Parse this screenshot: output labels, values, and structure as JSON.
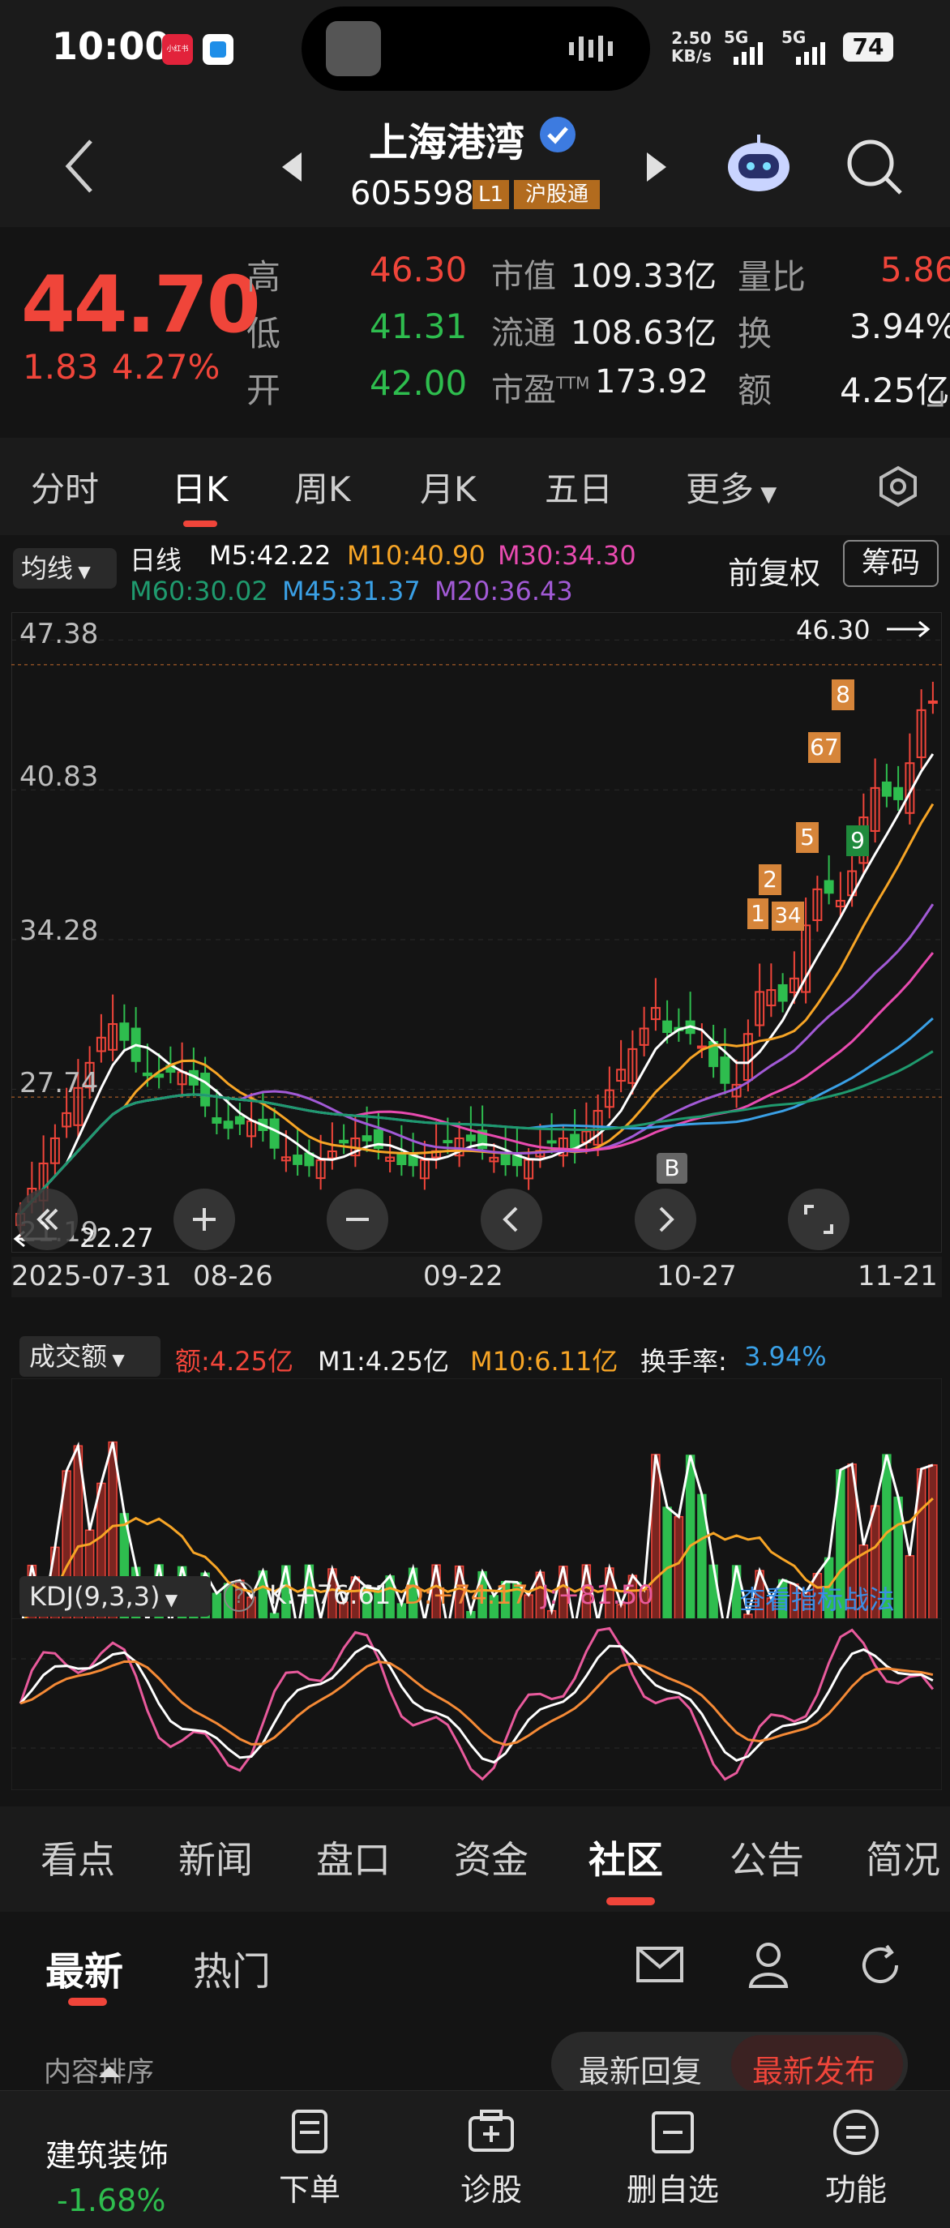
{
  "status_bar": {
    "time": "10:00",
    "app_badge_1": "小红书",
    "net_speed": "2.50",
    "net_unit": "KB/s",
    "sig1": "5G",
    "sig2": "5G",
    "battery": "74"
  },
  "header": {
    "stock_name": "上海港湾",
    "stock_code": "605598",
    "level": "L1",
    "market_tag": "沪股通"
  },
  "quote": {
    "price": "44.70",
    "change": "1.83",
    "change_pct": "4.27%",
    "high_label": "高",
    "high": "46.30",
    "low_label": "低",
    "low": "41.31",
    "open_label": "开",
    "open": "42.00",
    "mcap_label": "市值",
    "mcap": "109.33亿",
    "float_label": "流通",
    "float": "108.63亿",
    "pe_label": "市盈TTM",
    "pe": "173.92",
    "vr_label": "量比",
    "vr": "5.86",
    "turn_label": "换",
    "turn": "3.94%",
    "amt_label": "额",
    "amt": "4.25亿"
  },
  "tabs": [
    "分时",
    "日K",
    "周K",
    "月K",
    "五日",
    "更多"
  ],
  "ma_bar": {
    "selector": "均线",
    "period": "日线",
    "m5": "M5:42.22",
    "m10": "M10:40.90",
    "m30": "M30:34.30",
    "m60": "M60:30.02",
    "m45": "M45:31.37",
    "m20": "M20:36.43",
    "fuquan": "前复权",
    "chouma": "筹码"
  },
  "main_chart": {
    "y_labels": [
      "47.38",
      "40.83",
      "34.28",
      "27.74",
      "21.19"
    ],
    "high_mark": "46.30",
    "low_mark": "22.27",
    "x_labels": [
      "2025-07-31",
      "08-26",
      "09-22",
      "10-27",
      "11-21"
    ],
    "signal_b": "B",
    "markers": [
      "1",
      "2",
      "34",
      "5",
      "67",
      "8",
      "9"
    ]
  },
  "volume_panel": {
    "selector": "成交额",
    "amt": "额:4.25亿",
    "m1": "M1:4.25亿",
    "m10": "M10:6.11亿",
    "turnover_label": "换手率:",
    "turnover": "3.94%"
  },
  "kdj_panel": {
    "selector": "KDJ(9,3,3)",
    "k": "K:+76.61",
    "d": "D:+74.17",
    "j": "J:+81.50",
    "link": "查看指标战法"
  },
  "bottom_tabs": [
    "看点",
    "新闻",
    "盘口",
    "资金",
    "社区",
    "公告",
    "简况"
  ],
  "sub_tabs": {
    "latest": "最新",
    "hot": "热门"
  },
  "sort": {
    "label": "内容排序",
    "opt1": "最新回复",
    "opt2": "最新发布"
  },
  "dock": {
    "sector": "建筑装饰",
    "sector_change": "-1.68%",
    "items": [
      "下单",
      "诊股",
      "删自选",
      "功能"
    ]
  },
  "colors": {
    "up": "#f0453a",
    "down": "#2ebd4e",
    "m5": "#ffffff",
    "m10": "#f7a526",
    "m30": "#e84bb0",
    "m60": "#1f9a6e",
    "m45": "#3aa0e6",
    "m20": "#a25ad6"
  }
}
